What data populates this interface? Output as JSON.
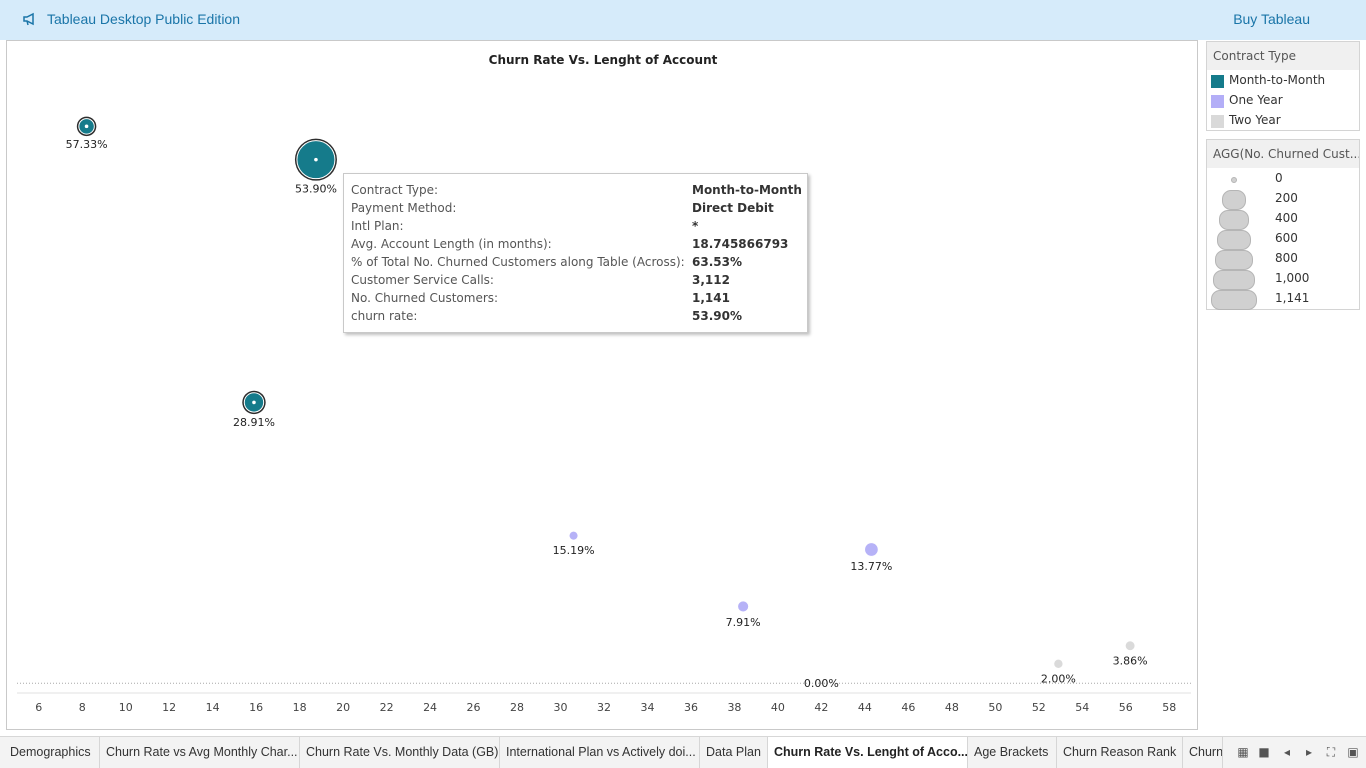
{
  "app": {
    "title": "Tableau Desktop Public Edition",
    "buy_label": "Buy Tableau"
  },
  "sheet": {
    "title": "Churn Rate Vs. Lenght of Account"
  },
  "colors": {
    "month_to_month": "#157b8b",
    "one_year": "#b3aef7",
    "two_year": "#d9d9d9",
    "topbar": "#d6ebfa",
    "accent_text": "#1a75a8"
  },
  "chart_data": {
    "type": "scatter",
    "title": "Churn Rate Vs. Lenght of Account",
    "xlabel": "",
    "ylabel": "",
    "xlim": [
      5,
      59
    ],
    "ylim": [
      -0.8,
      62
    ],
    "x_ticks": [
      6,
      8,
      10,
      12,
      14,
      16,
      18,
      20,
      22,
      24,
      26,
      28,
      30,
      32,
      34,
      36,
      38,
      40,
      42,
      44,
      46,
      48,
      50,
      52,
      54,
      56,
      58
    ],
    "size_field": "No. Churned Customers",
    "points": [
      {
        "x": 8.2,
        "y": 57.33,
        "label": "57.33%",
        "type": "Month-to-Month",
        "churned": 100
      },
      {
        "x": 18.75,
        "y": 53.9,
        "label": "53.90%",
        "type": "Month-to-Month",
        "churned": 1141
      },
      {
        "x": 15.9,
        "y": 28.91,
        "label": "28.91%",
        "type": "Month-to-Month",
        "churned": 200
      },
      {
        "x": 30.6,
        "y": 15.19,
        "label": "15.19%",
        "type": "One Year",
        "churned": 8
      },
      {
        "x": 44.3,
        "y": 13.77,
        "label": "13.77%",
        "type": "One Year",
        "churned": 60
      },
      {
        "x": 38.4,
        "y": 7.91,
        "label": "7.91%",
        "type": "One Year",
        "churned": 25
      },
      {
        "x": 52.9,
        "y": 2.0,
        "label": "2.00%",
        "type": "Two Year",
        "churned": 10
      },
      {
        "x": 56.2,
        "y": 3.86,
        "label": "3.86%",
        "type": "Two Year",
        "churned": 14
      },
      {
        "x": 42.0,
        "y": 0.0,
        "label": "0.00%",
        "type": "Two Year",
        "churned": 0
      }
    ],
    "reference_line_y": 0,
    "grid": false
  },
  "tooltip": {
    "rows": [
      {
        "key": "Contract Type:",
        "value": "Month-to-Month"
      },
      {
        "key": "Payment Method:",
        "value": "Direct Debit"
      },
      {
        "key": "Intl Plan:",
        "value": "*"
      },
      {
        "key": "Avg. Account Length (in months):",
        "value": "18.745866793"
      },
      {
        "key": "% of Total No. Churned Customers along Table (Across):",
        "value": "63.53%"
      },
      {
        "key": "Customer Service Calls:",
        "value": "3,112"
      },
      {
        "key": "No. Churned Customers:",
        "value": "1,141"
      },
      {
        "key": "churn rate:",
        "value": "53.90%"
      }
    ]
  },
  "legend_color": {
    "title": "Contract Type",
    "items": [
      {
        "label": "Month-to-Month",
        "color": "#157b8b"
      },
      {
        "label": "One Year",
        "color": "#b3aef7"
      },
      {
        "label": "Two Year",
        "color": "#d9d9d9"
      }
    ]
  },
  "legend_size": {
    "title": "AGG(No. Churned Cust...",
    "items": [
      {
        "label": "0",
        "value": 0
      },
      {
        "label": "200",
        "value": 200
      },
      {
        "label": "400",
        "value": 400
      },
      {
        "label": "600",
        "value": 600
      },
      {
        "label": "800",
        "value": 800
      },
      {
        "label": "1,000",
        "value": 1000
      },
      {
        "label": "1,141",
        "value": 1141
      }
    ]
  },
  "tabs": [
    {
      "label": "Demographics",
      "active": false
    },
    {
      "label": "Churn Rate vs Avg Monthly Char...",
      "active": false
    },
    {
      "label": "Churn Rate Vs. Monthly Data (GB)",
      "active": false
    },
    {
      "label": "International Plan vs Actively doi...",
      "active": false
    },
    {
      "label": "Data Plan",
      "active": false
    },
    {
      "label": "Churn Rate Vs. Lenght of Acco...",
      "active": true
    },
    {
      "label": "Age Brackets",
      "active": false
    },
    {
      "label": "Churn Reason Rank",
      "active": false
    },
    {
      "label": "Churn",
      "active": false
    }
  ]
}
